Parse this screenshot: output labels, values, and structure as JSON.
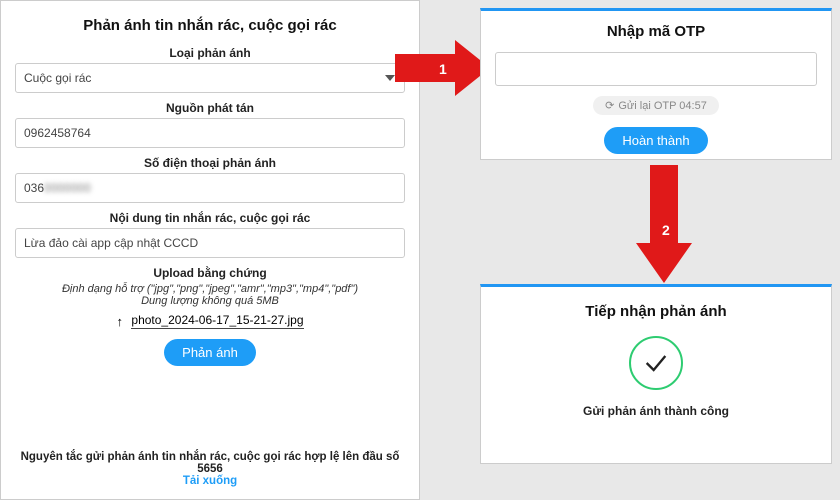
{
  "left": {
    "title": "Phản ánh tin nhắn rác, cuộc gọi rác",
    "type_label": "Loại phản ánh",
    "type_value": "Cuộc gọi rác",
    "source_label": "Nguồn phát tán",
    "source_value": "0962458764",
    "reporter_label": "Số điện thoại phản ánh",
    "reporter_prefix": "036",
    "content_label": "Nội dung tin nhắn rác, cuộc gọi rác",
    "content_value": "Lừa đảo cài app cập nhật CCCD",
    "upload_label": "Upload bằng chứng",
    "upload_hint1": "Định dạng hỗ trợ (\"jpg\",\"png\",\"jpeg\",\"amr\",\"mp3\",\"mp4\",\"pdf\")",
    "upload_hint2": "Dung lượng không quá 5MB",
    "upload_file": "photo_2024-06-17_15-21-27.jpg",
    "submit_label": "Phản ánh",
    "footer_note": "Nguyên tắc gửi phản ánh tin nhắn rác, cuộc gọi rác hợp lệ lên đầu số 5656",
    "download_label": "Tải xuống"
  },
  "otp": {
    "title": "Nhập mã OTP",
    "resend_label": "Gửi lại OTP 04:57",
    "done_label": "Hoàn thành"
  },
  "success": {
    "title": "Tiếp nhận phản ánh",
    "message": "Gửi phản ánh thành công"
  },
  "steps": {
    "s1": "1",
    "s2": "2"
  }
}
